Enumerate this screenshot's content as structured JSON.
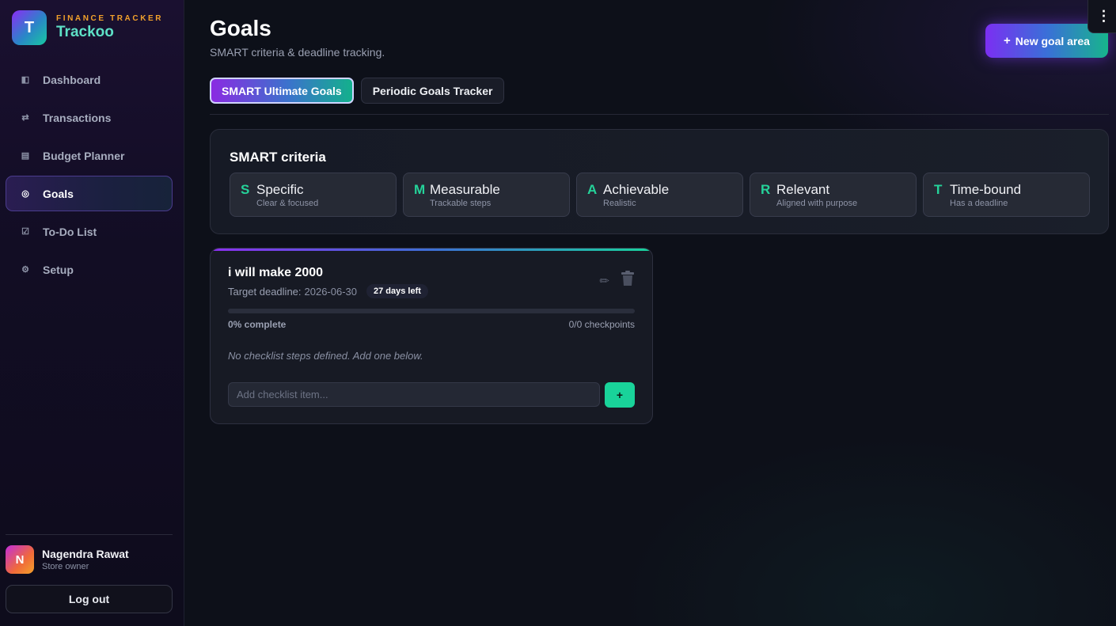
{
  "brand": {
    "logo_letter": "T",
    "tagline": "FINANCE TRACKER",
    "name": "Trackoo"
  },
  "nav": [
    {
      "label": "Dashboard",
      "icon": "◧",
      "icon_name": "dashboard-icon",
      "active": false
    },
    {
      "label": "Transactions",
      "icon": "⇄",
      "icon_name": "transfer-arrows-icon",
      "active": false
    },
    {
      "label": "Budget Planner",
      "icon": "▤",
      "icon_name": "ledger-icon",
      "active": false
    },
    {
      "label": "Goals",
      "icon": "◎",
      "icon_name": "target-icon",
      "active": true
    },
    {
      "label": "To-Do List",
      "icon": "☑",
      "icon_name": "checkbox-icon",
      "active": false
    },
    {
      "label": "Setup",
      "icon": "⚙",
      "icon_name": "gear-icon",
      "active": false
    }
  ],
  "user": {
    "initial": "N",
    "name": "Nagendra Rawat",
    "role": "Store owner"
  },
  "logout_label": "Log out",
  "header": {
    "title": "Goals",
    "subtitle": "SMART criteria & deadline tracking.",
    "new_goal_plus": "+",
    "new_goal_label": "New goal area",
    "menu_icon": "⋮"
  },
  "tabs": [
    {
      "label": "SMART Ultimate Goals",
      "active": true
    },
    {
      "label": "Periodic Goals Tracker",
      "active": false
    }
  ],
  "smart": {
    "title": "SMART criteria",
    "criteria": [
      {
        "letter": "S",
        "name": "Specific",
        "desc": "Clear & focused"
      },
      {
        "letter": "M",
        "name": "Measurable",
        "desc": "Trackable steps"
      },
      {
        "letter": "A",
        "name": "Achievable",
        "desc": "Realistic"
      },
      {
        "letter": "R",
        "name": "Relevant",
        "desc": "Aligned with purpose"
      },
      {
        "letter": "T",
        "name": "Time-bound",
        "desc": "Has a deadline"
      }
    ]
  },
  "goal": {
    "title": "i will make 2000",
    "deadline_label": "Target deadline:",
    "deadline_date": "2026-06-30",
    "days_left": "27 days left",
    "progress_percent": 0,
    "progress_label": "0% complete",
    "checkpoints_label": "0/0 checkpoints",
    "empty_message": "No checklist steps defined. Add one below.",
    "input_placeholder": "Add checklist item...",
    "input_value": "",
    "add_label": "+",
    "edit_icon": "✏",
    "delete_icon": "🗑"
  },
  "colors": {
    "accent_purple": "#8b2ff0",
    "accent_green": "#18d39c",
    "brand_orange": "#f2a12b",
    "brand_teal": "#5ee0c6"
  }
}
